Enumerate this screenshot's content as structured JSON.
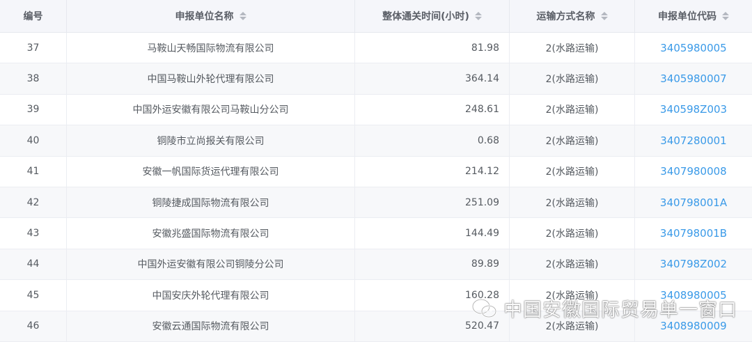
{
  "table": {
    "columns": [
      {
        "label": "编号",
        "sortable": false
      },
      {
        "label": "申报单位名称",
        "sortable": true
      },
      {
        "label": "整体通关时间(小时)",
        "sortable": true
      },
      {
        "label": "运输方式名称",
        "sortable": true
      },
      {
        "label": "申报单位代码",
        "sortable": true
      }
    ],
    "rows": [
      {
        "no": "37",
        "name": "马鞍山天畅国际物流有限公司",
        "time": "81.98",
        "transport": "2(水路运输)",
        "code": "3405980005"
      },
      {
        "no": "38",
        "name": "中国马鞍山外轮代理有限公司",
        "time": "364.14",
        "transport": "2(水路运输)",
        "code": "3405980007"
      },
      {
        "no": "39",
        "name": "中国外运安徽有限公司马鞍山分公司",
        "time": "248.61",
        "transport": "2(水路运输)",
        "code": "340598Z003"
      },
      {
        "no": "40",
        "name": "铜陵市立尚报关有限公司",
        "time": "0.68",
        "transport": "2(水路运输)",
        "code": "3407280001"
      },
      {
        "no": "41",
        "name": "安徽一帆国际货运代理有限公司",
        "time": "214.12",
        "transport": "2(水路运输)",
        "code": "3407980008"
      },
      {
        "no": "42",
        "name": "铜陵捷成国际物流有限公司",
        "time": "251.09",
        "transport": "2(水路运输)",
        "code": "340798001A"
      },
      {
        "no": "43",
        "name": "安徽兆盛国际物流有限公司",
        "time": "144.49",
        "transport": "2(水路运输)",
        "code": "340798001B"
      },
      {
        "no": "44",
        "name": "中国外运安徽有限公司铜陵分公司",
        "time": "89.89",
        "transport": "2(水路运输)",
        "code": "340798Z002"
      },
      {
        "no": "45",
        "name": "中国安庆外轮代理有限公司",
        "time": "160.28",
        "transport": "2(水路运输)",
        "code": "3408980005"
      },
      {
        "no": "46",
        "name": "安徽云通国际物流有限公司",
        "time": "520.47",
        "transport": "2(水路运输)",
        "code": "3408980009"
      }
    ]
  },
  "watermark": {
    "text": "中国安徽国际贸易单一窗口",
    "icon": "wechat-icon"
  },
  "colors": {
    "header_bg": "#f5f6fa",
    "row_alt_bg": "#f7f8fa",
    "link": "#3a9ae8"
  }
}
